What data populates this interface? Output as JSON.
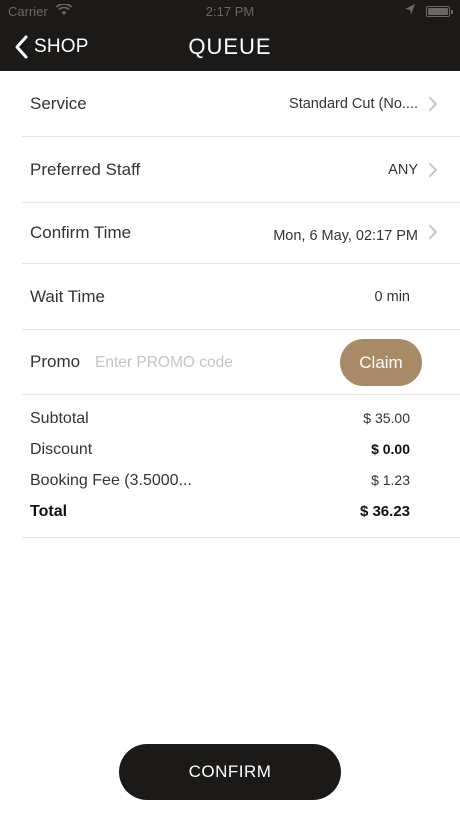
{
  "status_bar": {
    "carrier": "Carrier",
    "time": "2:17 PM"
  },
  "nav": {
    "back_label": "SHOP",
    "title": "QUEUE"
  },
  "rows": {
    "service": {
      "label": "Service",
      "value": "Standard Cut (No...."
    },
    "preferred_staff": {
      "label": "Preferred Staff",
      "value": "ANY"
    },
    "confirm_time": {
      "label": "Confirm Time",
      "value": "Mon, 6 May, 02:17 PM"
    },
    "wait_time": {
      "label": "Wait Time",
      "value": "0 min"
    }
  },
  "promo": {
    "label": "Promo",
    "placeholder": "Enter PROMO code",
    "claim_label": "Claim"
  },
  "summary": {
    "subtotal_label": "Subtotal",
    "subtotal_value": "$ 35.00",
    "discount_label": "Discount",
    "discount_value": "$ 0.00",
    "booking_fee_label": "Booking Fee (3.5000...",
    "booking_fee_value": "$ 1.23",
    "total_label": "Total",
    "total_value": "$ 36.23"
  },
  "confirm_label": "CONFIRM",
  "colors": {
    "header_bg": "#1c1a18",
    "accent": "#a98a66",
    "button_bg": "#1c1a18"
  }
}
